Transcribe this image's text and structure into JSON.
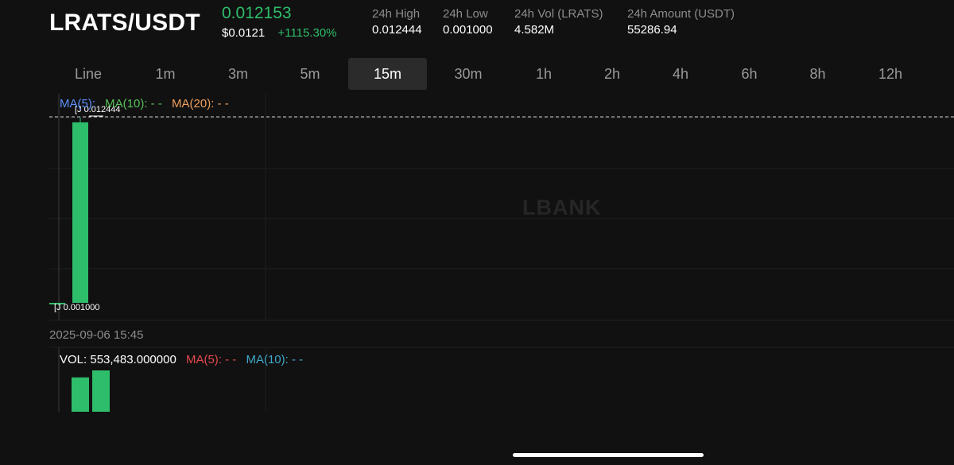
{
  "header": {
    "pair": "LRATS/USDT",
    "last_price": "0.012153",
    "usd_price": "$0.0121",
    "change_pct": "+1115.30%",
    "stats": [
      {
        "label": "24h High",
        "value": "0.012444"
      },
      {
        "label": "24h Low",
        "value": "0.001000"
      },
      {
        "label": "24h Vol (LRATS)",
        "value": "4.582M"
      },
      {
        "label": "24h Amount (USDT)",
        "value": "55286.94"
      }
    ]
  },
  "tabs": [
    "Line",
    "1m",
    "3m",
    "5m",
    "15m",
    "30m",
    "1h",
    "2h",
    "4h",
    "6h",
    "8h",
    "12h"
  ],
  "active_tab": "15m",
  "chart": {
    "watermark": "LBANK",
    "ma_labels": {
      "ma5": "MA(5):",
      "ma10": "MA(10): - -",
      "ma20": "MA(20): - -"
    },
    "high_marker": "0.012444",
    "low_marker": "0.001000",
    "timestamp": "2025-09-06 15:45",
    "volume": {
      "label": "VOL: 553,483.000000",
      "ma5": "MA(5): - -",
      "ma10": "MA(10): - -"
    }
  },
  "colors": {
    "up": "#2ebd6b",
    "ma5": "#5b8ff9",
    "ma10": "#5ac15a",
    "ma20": "#f0a05a",
    "vol_ma5": "#e5484d",
    "vol_ma10": "#3fa8c8"
  },
  "chart_data": {
    "type": "candlestick",
    "candles": [
      {
        "open": 0.001,
        "high": 0.001,
        "low": 0.001,
        "close": 0.001
      },
      {
        "open": 0.001,
        "high": 0.012444,
        "low": 0.001,
        "close": 0.012153
      }
    ],
    "volume": [
      460000,
      553483
    ],
    "price_range": [
      0.001,
      0.012444
    ]
  }
}
